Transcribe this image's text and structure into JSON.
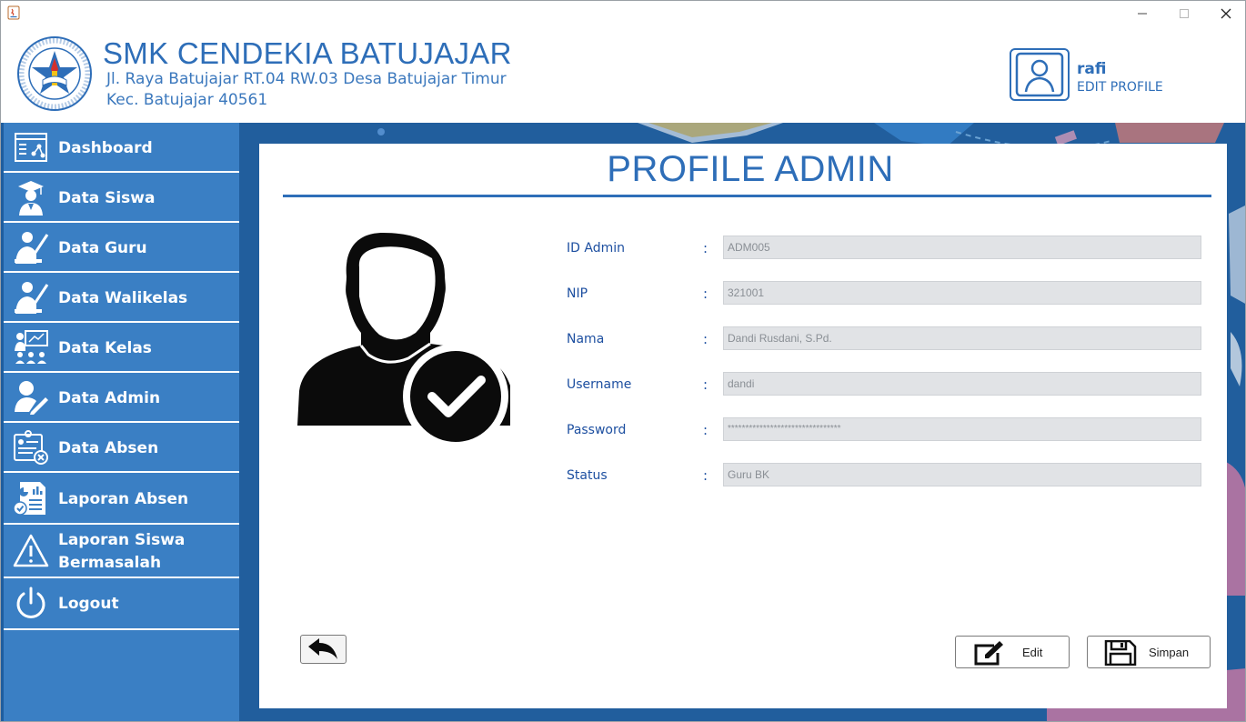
{
  "header": {
    "school_name": "SMK CENDEKIA BATUJAJAR",
    "address_line1": "Jl. Raya Batujajar RT.04 RW.03 Desa Batujajar Timur",
    "address_line2": "Kec. Batujajar 40561",
    "logo_icon": "school-seal-logo",
    "profile": {
      "username": "rafi",
      "edit_label": "EDIT PROFILE"
    }
  },
  "window_controls": {
    "minimize": "—",
    "maximize": "☐",
    "close": "✕"
  },
  "sidebar": {
    "items": [
      {
        "label": "Dashboard",
        "icon": "dashboard-icon"
      },
      {
        "label": "Data Siswa",
        "icon": "student-icon"
      },
      {
        "label": "Data Guru",
        "icon": "teacher-icon"
      },
      {
        "label": "Data Walikelas",
        "icon": "homeroom-teacher-icon"
      },
      {
        "label": "Data Kelas",
        "icon": "classroom-icon"
      },
      {
        "label": "Data Admin",
        "icon": "admin-edit-icon"
      },
      {
        "label": "Data Absen",
        "icon": "attendance-icon"
      },
      {
        "label": "Laporan Absen",
        "icon": "report-icon"
      },
      {
        "label": "Laporan Siswa Bermasalah",
        "label_line1": "Laporan Siswa",
        "label_line2": "Bermasalah",
        "icon": "warning-icon"
      },
      {
        "label": "Logout",
        "icon": "power-icon"
      }
    ]
  },
  "main": {
    "title": "PROFILE ADMIN",
    "fields": [
      {
        "label": "ID Admin",
        "value": "ADM005"
      },
      {
        "label": "NIP",
        "value": "321001"
      },
      {
        "label": "Nama",
        "value": "Dandi Rusdani, S.Pd."
      },
      {
        "label": "Username",
        "value": "dandi"
      },
      {
        "label": "Password",
        "value": "********************************"
      },
      {
        "label": "Status",
        "value": "Guru BK"
      }
    ],
    "colon": ":",
    "buttons": {
      "edit": "Edit",
      "save": "Simpan"
    }
  },
  "colors": {
    "accent": "#2e6eb8",
    "sidebar": "#3a7fc4",
    "background": "#1f5e9f",
    "field_bg": "#e1e3e6",
    "label": "#1d4fa0"
  }
}
